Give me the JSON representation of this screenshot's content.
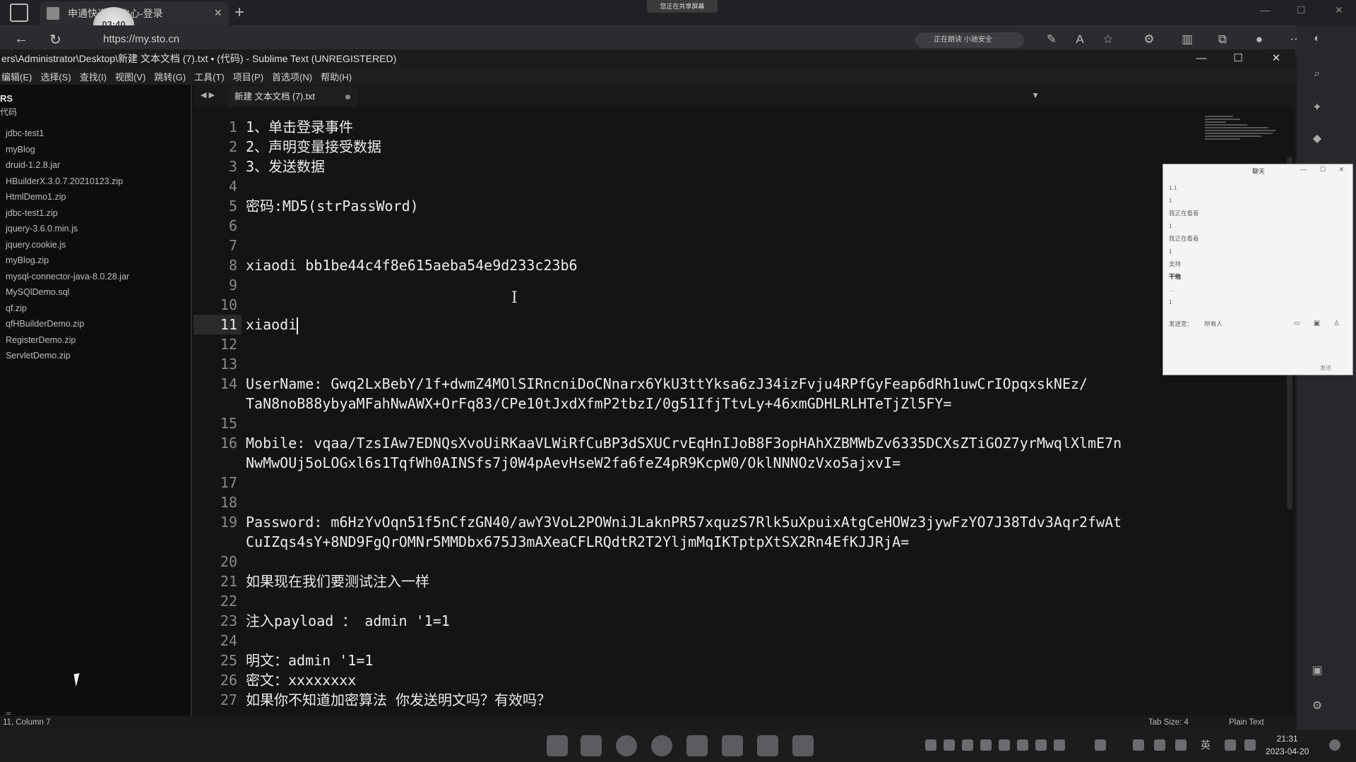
{
  "browser": {
    "tab_title": "申通快递… 中心-登录",
    "recorder_time": "03:40",
    "share_text": "您正在共享屏幕",
    "url": "https://my.sto.cn",
    "reading_aloud": "正在朗读 小驰安全"
  },
  "sublime": {
    "title": "ers\\Administrator\\Desktop\\新建 文本文档 (7).txt • (代码) - Sublime Text (UNREGISTERED)",
    "menu": [
      "编辑(E)",
      "选择(S)",
      "查找(I)",
      "视图(V)",
      "跳转(G)",
      "工具(T)",
      "项目(P)",
      "首选项(N)",
      "帮助(H)"
    ],
    "sidebar": {
      "header": "RS",
      "folder": "代码",
      "files": [
        "jdbc-test1",
        "myBlog",
        "druid-1.2.8.jar",
        "HBuilderX.3.0.7.20210123.zip",
        "HtmlDemo1.zip",
        "jdbc-test1.zip",
        "jquery-3.6.0.min.js",
        "jquery.cookie.js",
        "myBlog.zip",
        "mysql-connector-java-8.0.28.jar",
        "MySQlDemo.sql",
        "qf.zip",
        "qfHBuilderDemo.zip",
        "RegisterDemo.zip",
        "ServletDemo.zip"
      ]
    },
    "tab": "新建 文本文档 (7).txt",
    "gutter": [
      "1",
      "2",
      "3",
      "4",
      "5",
      "6",
      "7",
      "8",
      "9",
      "10",
      "11",
      "12",
      "13",
      "14",
      "15",
      "16",
      "17",
      "18",
      "19",
      "20",
      "21",
      "22",
      "23",
      "24",
      "25",
      "26",
      "27"
    ],
    "code": {
      "l1": "1、单击登录事件",
      "l2": "2、声明变量接受数据",
      "l3": "3、发送数据",
      "l5": "密码:MD5(strPassWord)",
      "l8": "xiaodi bb1be44c4f8e615aeba54e9d233c23b6",
      "l11": "xiaodi",
      "l14a": "UserName: Gwq2LxBebY/1f+dwmZ4MOlSIRncniDoCNnarx6YkU3ttYksa6zJ34izFvju4RPfGyFeap6dRh1uwCrIOpqxskNEz/",
      "l14b": "TaN8noB88ybyaMFahNwAWX+OrFq83/CPe10tJxdXfmP2tbzI/0g51IfjTtvLy+46xmGDHLRLHTeTjZl5FY=",
      "l16a": "Mobile: vqaa/TzsIAw7EDNQsXvoUiRKaaVLWiRfCuBP3dSXUCrvEqHnIJoB8F3opHAhXZBMWbZv6335DCXsZTiGOZ7yrMwqlXlmE7n",
      "l16b": "NwMwOUj5oLOGxl6s1TqfWh0AINSfs7j0W4pAevHseW2fa6feZ4pR9KcpW0/OklNNNOzVxo5ajxvI=",
      "l19a": "Password: m6HzYvOqn51f5nCfzGN40/awY3VoL2POWniJLaknPR57xquzS7Rlk5uXpuixAtgCeHOWz3jywFzYO7J38Tdv3Aqr2fwAt",
      "l19b": "CuIZqs4sY+8ND9FgQrOMNr5MMDbx675J3mAXeaCFLRQdtR2T2YljmMqIKTptpXtSX2Rn4EfKJJRjA=",
      "l21": "如果现在我们要测试注入一样",
      "l23": "注入payload ： admin '1=1",
      "l25": "明文：admin '1=1",
      "l26": "密文：xxxxxxxx",
      "l27": "如果你不知道加密算法 你发送明文吗？有效吗？"
    },
    "status_left": "11, Column 7",
    "status_tab": "Tab Size: 4",
    "status_syntax": "Plain Text"
  },
  "chat": {
    "title": "聊天",
    "messages": [
      "1.1",
      "1",
      "我正在看着",
      "1",
      "我正在看着",
      "1",
      "支持",
      "干他",
      "…",
      "1"
    ],
    "send_to_label": "发送至：",
    "send_to_value": "所有人",
    "footer": "发送"
  },
  "taskbar": {
    "lang": "英",
    "time": "21:31",
    "date": "2023-04-20"
  }
}
